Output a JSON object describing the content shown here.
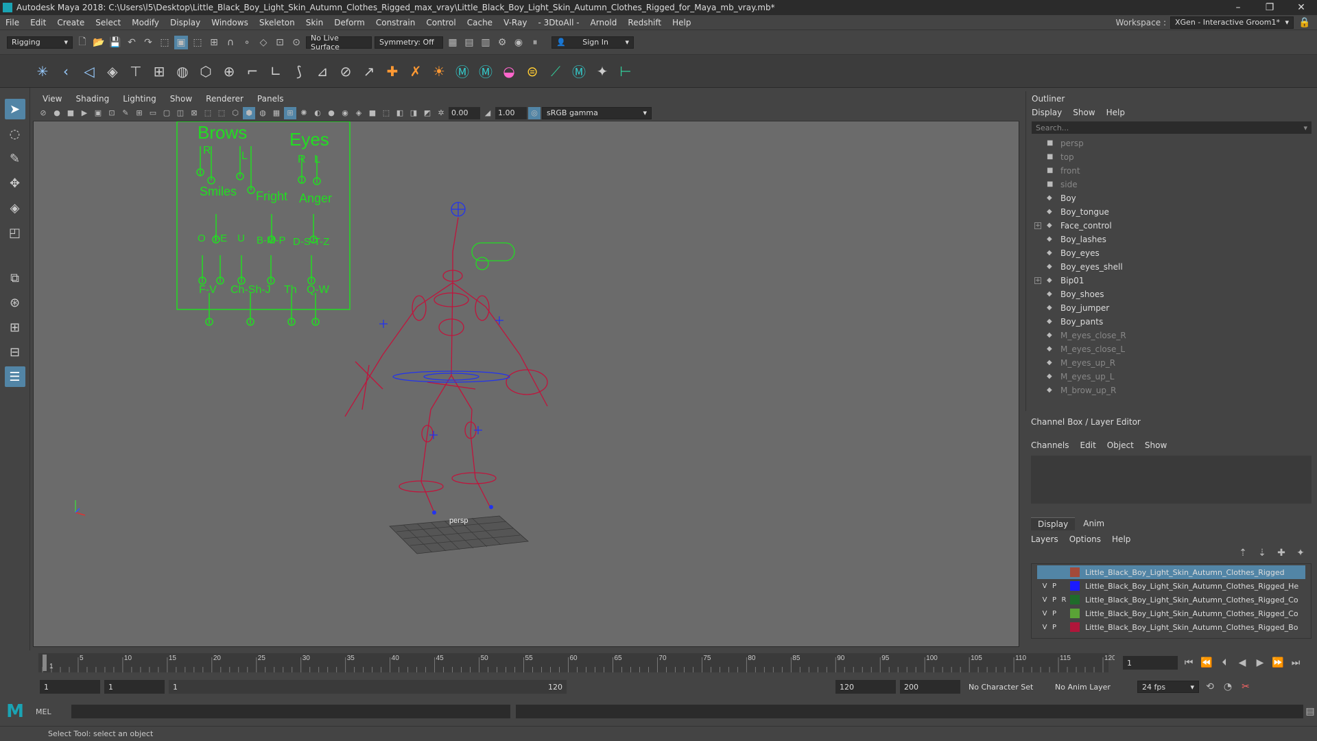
{
  "window": {
    "title": "Autodesk Maya 2018: C:\\Users\\l5\\Desktop\\Little_Black_Boy_Light_Skin_Autumn_Clothes_Rigged_max_vray\\Little_Black_Boy_Light_Skin_Autumn_Clothes_Rigged_for_Maya_mb_vray.mb*",
    "minimize": "–",
    "restore": "❐",
    "close": "✕"
  },
  "menu": [
    "File",
    "Edit",
    "Create",
    "Select",
    "Modify",
    "Display",
    "Windows",
    "Skeleton",
    "Skin",
    "Deform",
    "Constrain",
    "Control",
    "Cache",
    "V-Ray",
    "- 3DtoAll -",
    "Arnold",
    "Redshift",
    "Help"
  ],
  "workspace": {
    "label": "Workspace :",
    "value": "XGen - Interactive Groom1*"
  },
  "statusline": {
    "mode": "Rigging",
    "live_surface": "No Live Surface",
    "symmetry": "Symmetry: Off",
    "sign_in": "Sign In"
  },
  "viewport": {
    "menu": [
      "View",
      "Shading",
      "Lighting",
      "Show",
      "Renderer",
      "Panels"
    ],
    "exposure": "0.00",
    "gamma": "1.00",
    "color_space": "sRGB gamma",
    "camera_label": "persp",
    "face_board": {
      "brows": "Brows",
      "eyes": "Eyes",
      "r1": "R",
      "l1": "L",
      "r2": "R",
      "l2": "L",
      "smiles": "Smiles",
      "fright": "Fright",
      "anger": "Anger",
      "o": "O",
      "ie": "I-E",
      "u": "U",
      "bmp": "B-M-P",
      "dstz": "D-S-T-Z",
      "fv": "F-V",
      "chshj": "Ch-Sh-J",
      "th": "Th",
      "qw": "Q-W"
    }
  },
  "outliner": {
    "title": "Outliner",
    "menu": [
      "Display",
      "Show",
      "Help"
    ],
    "search_placeholder": "Search...",
    "items": [
      {
        "name": "persp",
        "dim": true,
        "expand": false
      },
      {
        "name": "top",
        "dim": true,
        "expand": false
      },
      {
        "name": "front",
        "dim": true,
        "expand": false
      },
      {
        "name": "side",
        "dim": true,
        "expand": false
      },
      {
        "name": "Boy",
        "dim": false,
        "expand": false
      },
      {
        "name": "Boy_tongue",
        "dim": false,
        "expand": false
      },
      {
        "name": "Face_control",
        "dim": false,
        "expand": true
      },
      {
        "name": "Boy_lashes",
        "dim": false,
        "expand": false
      },
      {
        "name": "Boy_eyes",
        "dim": false,
        "expand": false
      },
      {
        "name": "Boy_eyes_shell",
        "dim": false,
        "expand": false
      },
      {
        "name": "Bip01",
        "dim": false,
        "expand": true
      },
      {
        "name": "Boy_shoes",
        "dim": false,
        "expand": false
      },
      {
        "name": "Boy_jumper",
        "dim": false,
        "expand": false
      },
      {
        "name": "Boy_pants",
        "dim": false,
        "expand": false
      },
      {
        "name": "M_eyes_close_R",
        "dim": true,
        "expand": false
      },
      {
        "name": "M_eyes_close_L",
        "dim": true,
        "expand": false
      },
      {
        "name": "M_eyes_up_R",
        "dim": true,
        "expand": false
      },
      {
        "name": "M_eyes_up_L",
        "dim": true,
        "expand": false
      },
      {
        "name": "M_brow_up_R",
        "dim": true,
        "expand": false
      }
    ]
  },
  "channelbox": {
    "title": "Channel Box / Layer Editor",
    "menu": [
      "Channels",
      "Edit",
      "Object",
      "Show"
    ]
  },
  "layers": {
    "tabs": [
      "Display",
      "Anim"
    ],
    "menu": [
      "Layers",
      "Options",
      "Help"
    ],
    "rows": [
      {
        "v": "",
        "p": "",
        "r": "",
        "color": "#a34a3a",
        "name": "Little_Black_Boy_Light_Skin_Autumn_Clothes_Rigged",
        "selected": true
      },
      {
        "v": "V",
        "p": "P",
        "r": "",
        "color": "#1a1aff",
        "name": "Little_Black_Boy_Light_Skin_Autumn_Clothes_Rigged_He",
        "selected": false
      },
      {
        "v": "V",
        "p": "P",
        "r": "R",
        "color": "#1f6b2a",
        "name": "Little_Black_Boy_Light_Skin_Autumn_Clothes_Rigged_Co",
        "selected": false
      },
      {
        "v": "V",
        "p": "P",
        "r": "",
        "color": "#5aa336",
        "name": "Little_Black_Boy_Light_Skin_Autumn_Clothes_Rigged_Co",
        "selected": false
      },
      {
        "v": "V",
        "p": "P",
        "r": "",
        "color": "#b0163a",
        "name": "Little_Black_Boy_Light_Skin_Autumn_Clothes_Rigged_Bo",
        "selected": false
      }
    ]
  },
  "timeline": {
    "ticks": [
      "5",
      "10",
      "15",
      "20",
      "25",
      "30",
      "35",
      "40",
      "45",
      "50",
      "55",
      "60",
      "65",
      "70",
      "75",
      "80",
      "85",
      "90",
      "95",
      "100",
      "105",
      "110",
      "115",
      "120"
    ],
    "start_tick": "1",
    "current_frame": "1"
  },
  "range": {
    "start": "1",
    "anim_start": "1",
    "slider_start": "1",
    "slider_end": "120",
    "end": "120",
    "anim_end": "200",
    "character_set": "No Character Set",
    "anim_layer": "No Anim Layer",
    "fps": "24 fps"
  },
  "cmd": {
    "label": "MEL"
  },
  "help": {
    "text": "Select Tool: select an object"
  },
  "colors": {
    "accent": "#5285a6",
    "control_green": "#22dd22",
    "rig_red": "#c0143c",
    "viewport_bg": "#6b6b6b"
  }
}
